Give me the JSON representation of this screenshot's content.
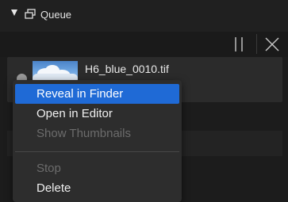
{
  "panel": {
    "title": "Queue"
  },
  "toolbar": {
    "pause_icon": "pause-icon",
    "close_icon": "close-icon"
  },
  "queue_items": [
    {
      "filename": "H6_blue_0010.tif",
      "status_icon": "checkmark-icon",
      "thumbnail": "sky-clouds-thumbnail"
    }
  ],
  "context_menu": {
    "items": [
      {
        "label": "Reveal in Finder",
        "state": "selected"
      },
      {
        "label": "Open in Editor",
        "state": "enabled"
      },
      {
        "label": "Show Thumbnails",
        "state": "disabled"
      },
      {
        "label": "Stop",
        "state": "disabled"
      },
      {
        "label": "Delete",
        "state": "enabled"
      }
    ]
  },
  "colors": {
    "background": "#1c1c1c",
    "row": "#2b2b2b",
    "menu": "#2d2d2d",
    "selection": "#1f6ad6",
    "disabled_text": "#6c6c6c"
  }
}
